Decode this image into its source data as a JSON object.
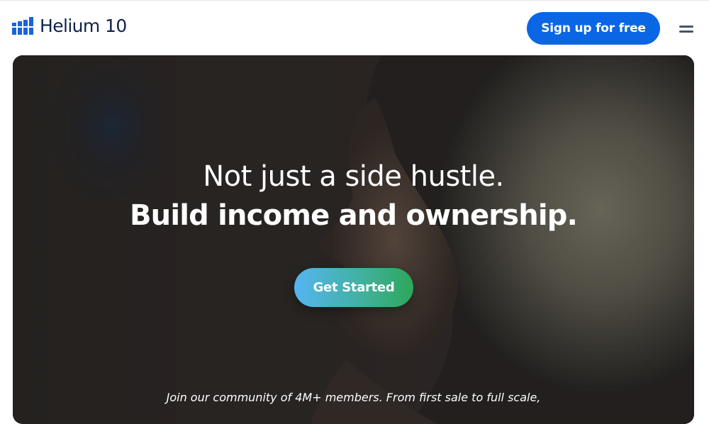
{
  "brand": {
    "name": "Helium 10",
    "color": "#0f2249",
    "logo_color": "#1a63d8"
  },
  "header": {
    "signup_label": "Sign up for free",
    "signup_color": "#0a66e4",
    "menu_icon": "hamburger-menu-icon"
  },
  "hero": {
    "headline_line1": "Not just a side hustle.",
    "headline_line2": "Build income and ownership.",
    "cta_label": "Get Started",
    "subtext": "Join our community of 4M+ members. From first sale to full scale,",
    "background": "photo-woman-smiling"
  }
}
